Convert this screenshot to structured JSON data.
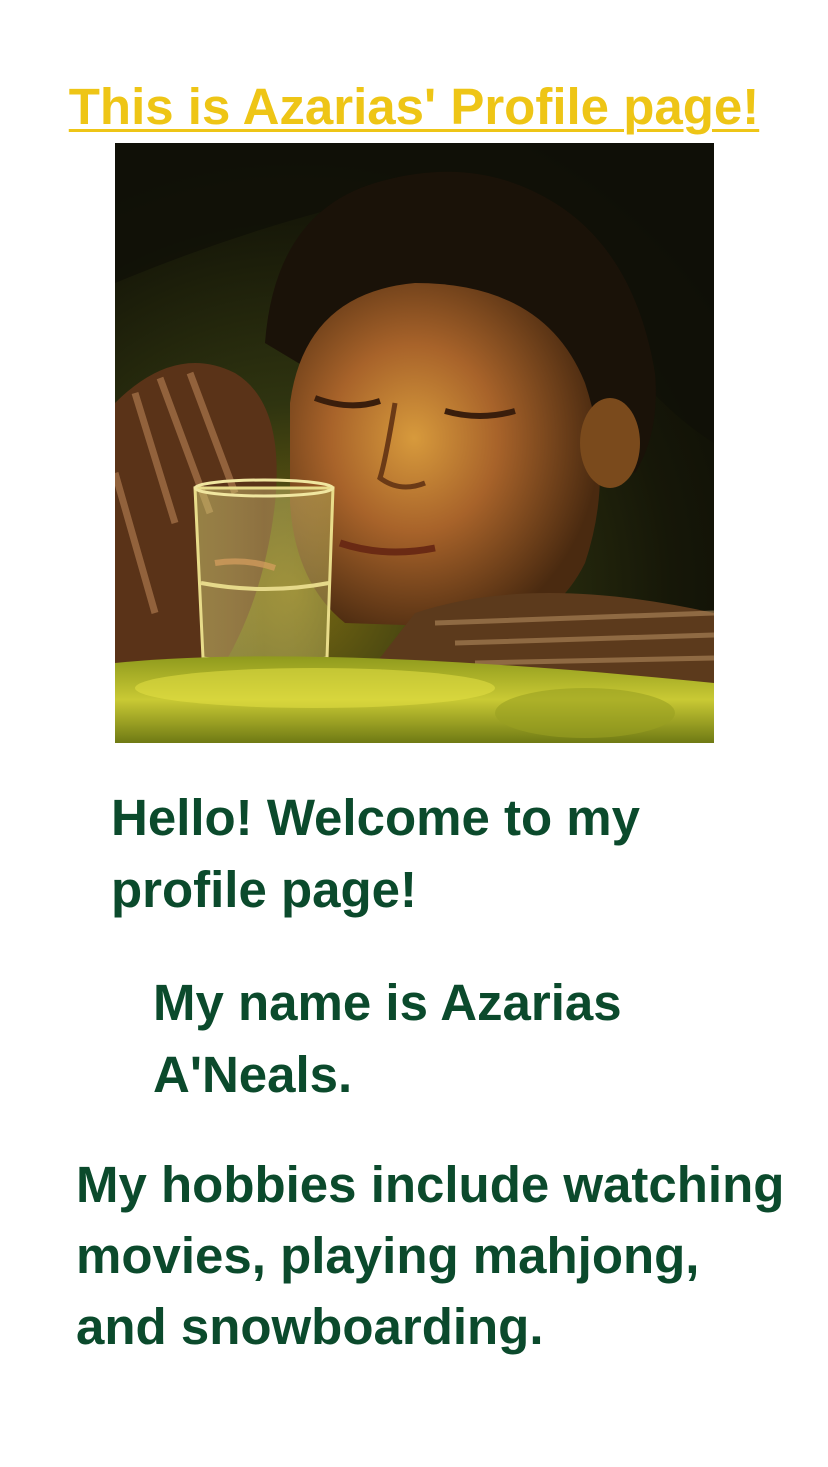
{
  "header": {
    "title": "This is Azarias' Profile page!",
    "title_color": "#eec516"
  },
  "profile": {
    "photo_alt": "Photo of a young man resting his head on a table next to a glass, lit by warm yellow light"
  },
  "content": {
    "greeting": "Hello! Welcome to my profile page!",
    "name": "My name is Azarias A'Neals.",
    "hobbies": "My hobbies include watching movies, playing mahjong, and snowboarding.",
    "text_color": "#0b4a2c"
  }
}
